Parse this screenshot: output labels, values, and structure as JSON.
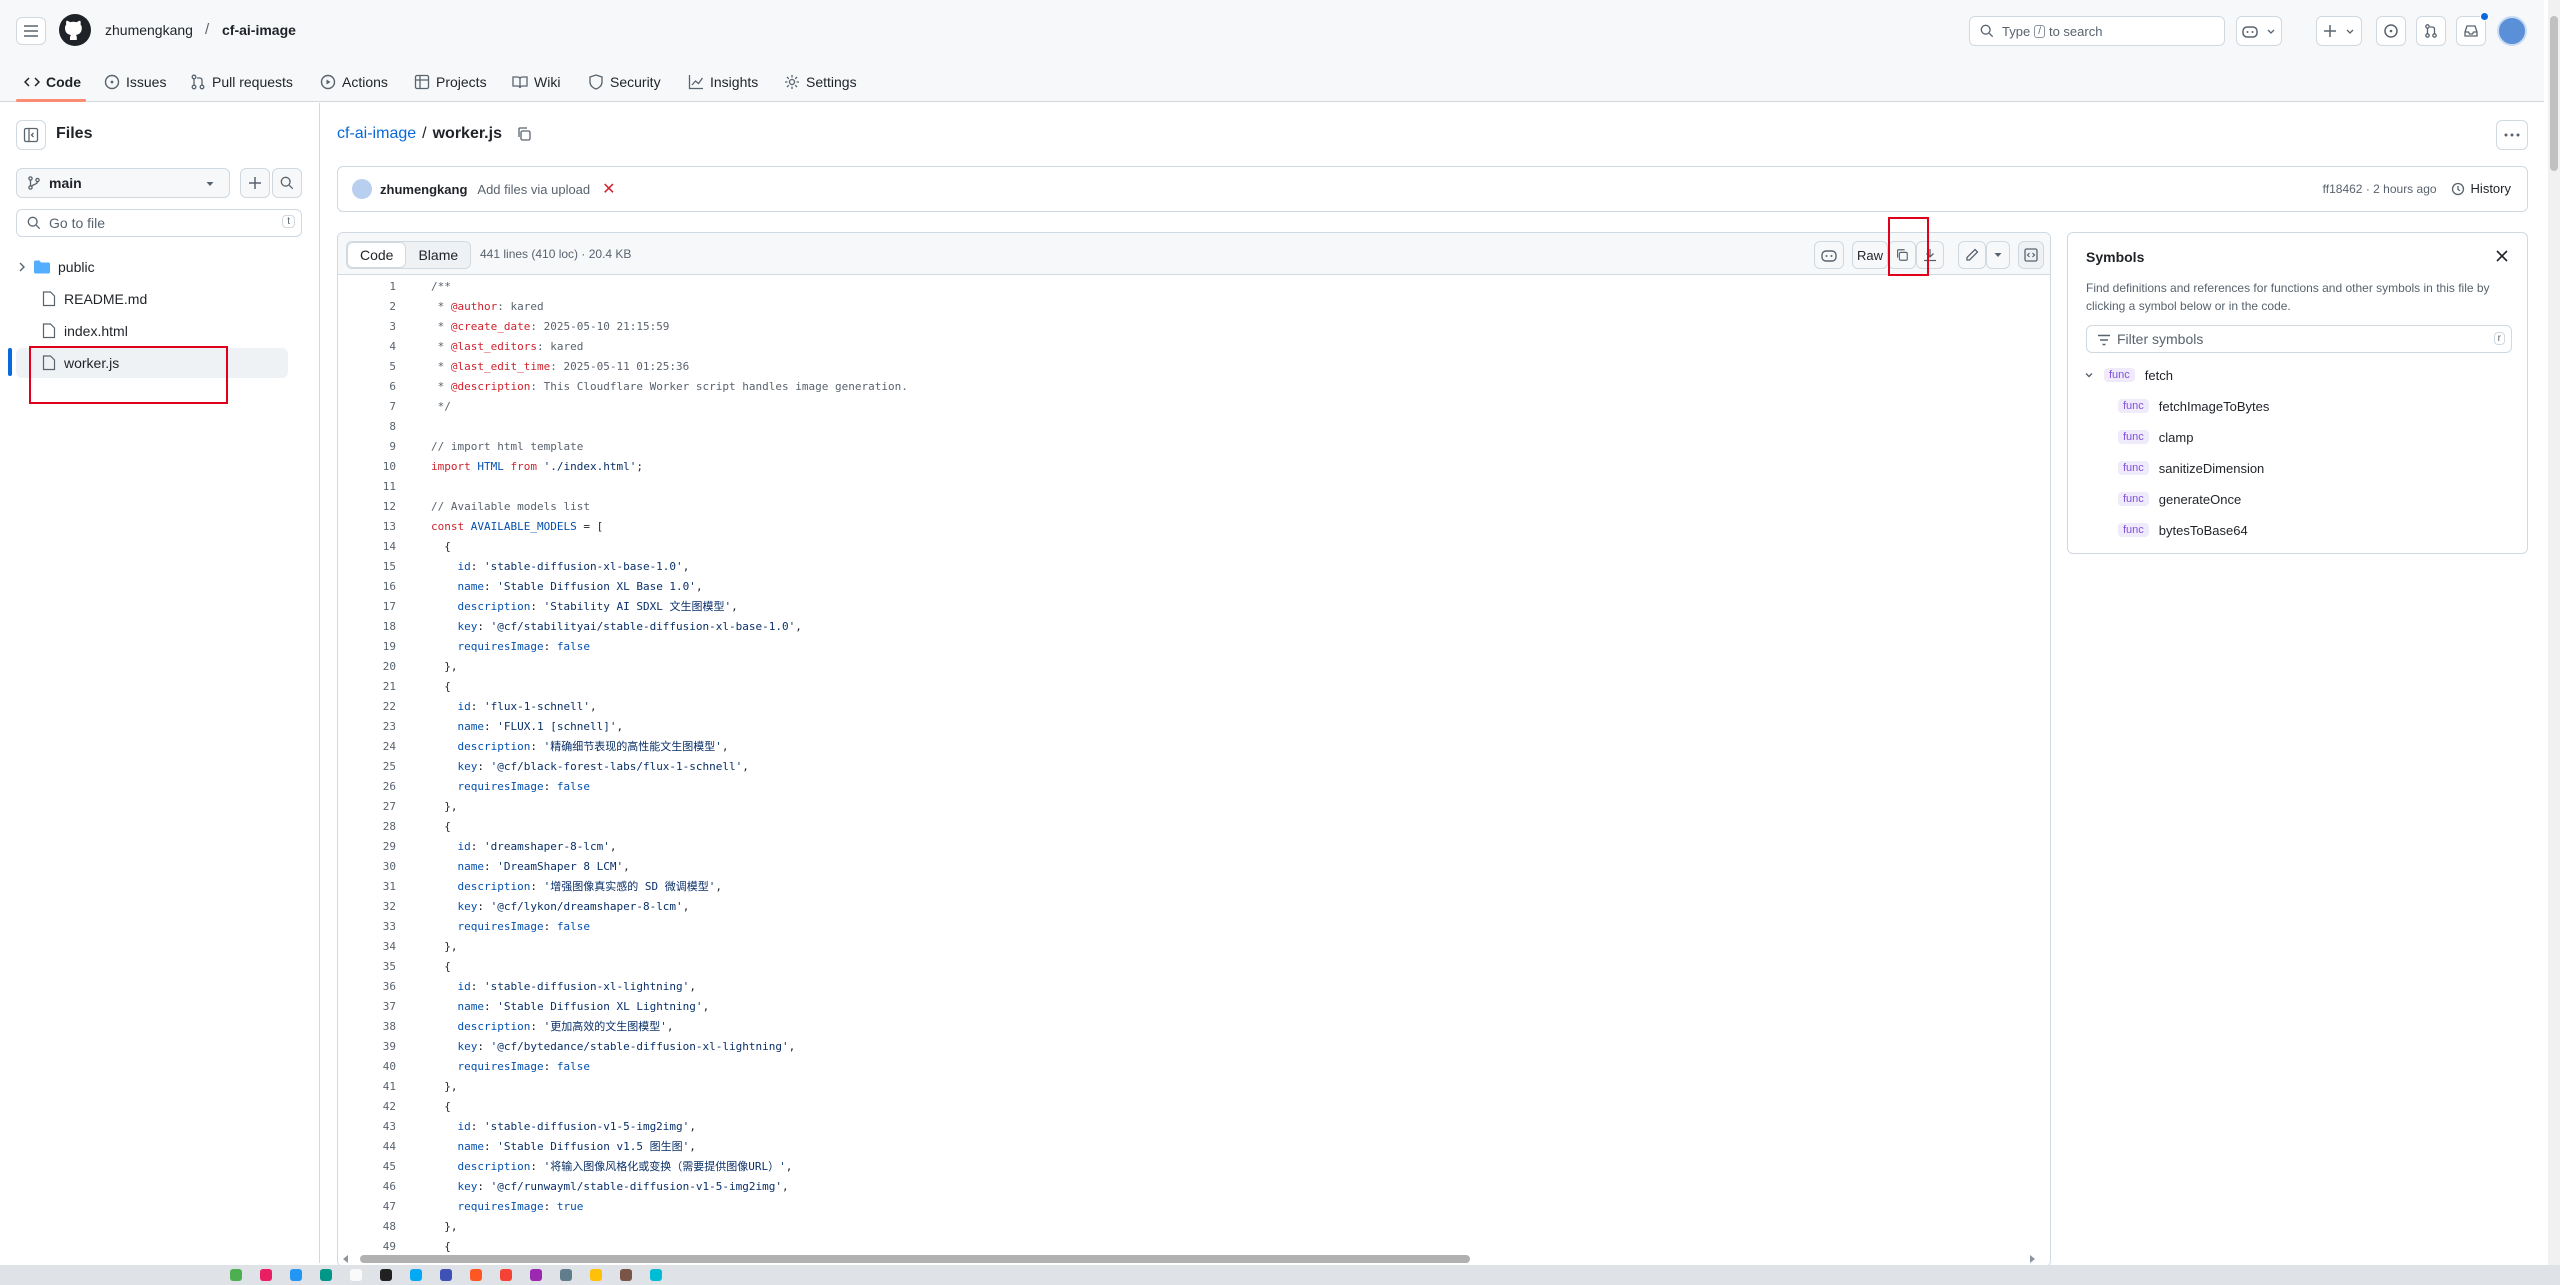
{
  "header": {
    "owner": "zhumengkang",
    "separator": "/",
    "repo": "cf-ai-image",
    "search_prefix": "Type",
    "search_key": "/",
    "search_suffix": "to search"
  },
  "nav_tabs": [
    {
      "label": "Code",
      "icon": "code-icon"
    },
    {
      "label": "Issues",
      "icon": "issue-icon"
    },
    {
      "label": "Pull requests",
      "icon": "pull-request-icon"
    },
    {
      "label": "Actions",
      "icon": "actions-icon"
    },
    {
      "label": "Projects",
      "icon": "projects-icon"
    },
    {
      "label": "Wiki",
      "icon": "wiki-icon"
    },
    {
      "label": "Security",
      "icon": "shield-icon"
    },
    {
      "label": "Insights",
      "icon": "graph-icon"
    },
    {
      "label": "Settings",
      "icon": "gear-icon"
    }
  ],
  "sidebar": {
    "title": "Files",
    "branch": "main",
    "goto_placeholder": "Go to file",
    "goto_key": "t",
    "tree": [
      {
        "name": "public",
        "type": "folder"
      },
      {
        "name": "README.md",
        "type": "file"
      },
      {
        "name": "index.html",
        "type": "file"
      },
      {
        "name": "worker.js",
        "type": "file",
        "selected": true
      }
    ]
  },
  "path": {
    "repo": "cf-ai-image",
    "sep": "/",
    "file": "worker.js"
  },
  "commit": {
    "author": "zhumengkang",
    "message": "Add files via upload",
    "status": "✕",
    "sha": "ff18462",
    "time": "· 2 hours ago",
    "history": "History"
  },
  "code_toolbar": {
    "tab_code": "Code",
    "tab_blame": "Blame",
    "meta": "441 lines (410 loc) · 20.4 KB",
    "raw": "Raw"
  },
  "code_lines": [
    {
      "n": "1",
      "t": "/**"
    },
    {
      "n": "2",
      "t": " * @author: kared"
    },
    {
      "n": "3",
      "t": " * @create_date: 2025-05-10 21:15:59"
    },
    {
      "n": "4",
      "t": " * @last_editors: kared"
    },
    {
      "n": "5",
      "t": " * @last_edit_time: 2025-05-11 01:25:36"
    },
    {
      "n": "6",
      "t": " * @description: This Cloudflare Worker script handles image generation."
    },
    {
      "n": "7",
      "t": " */"
    },
    {
      "n": "8",
      "t": ""
    },
    {
      "n": "9",
      "t": "// import html template"
    },
    {
      "n": "10",
      "t": "import HTML from './index.html';"
    },
    {
      "n": "11",
      "t": ""
    },
    {
      "n": "12",
      "t": "// Available models list"
    },
    {
      "n": "13",
      "t": "const AVAILABLE_MODELS = ["
    },
    {
      "n": "14",
      "t": "  {"
    },
    {
      "n": "15",
      "t": "    id: 'stable-diffusion-xl-base-1.0',"
    },
    {
      "n": "16",
      "t": "    name: 'Stable Diffusion XL Base 1.0',"
    },
    {
      "n": "17",
      "t": "    description: 'Stability AI SDXL 文生图模型',"
    },
    {
      "n": "18",
      "t": "    key: '@cf/stabilityai/stable-diffusion-xl-base-1.0',"
    },
    {
      "n": "19",
      "t": "    requiresImage: false"
    },
    {
      "n": "20",
      "t": "  },"
    },
    {
      "n": "21",
      "t": "  {"
    },
    {
      "n": "22",
      "t": "    id: 'flux-1-schnell',"
    },
    {
      "n": "23",
      "t": "    name: 'FLUX.1 [schnell]',"
    },
    {
      "n": "24",
      "t": "    description: '精确细节表现的高性能文生图模型',"
    },
    {
      "n": "25",
      "t": "    key: '@cf/black-forest-labs/flux-1-schnell',"
    },
    {
      "n": "26",
      "t": "    requiresImage: false"
    },
    {
      "n": "27",
      "t": "  },"
    },
    {
      "n": "28",
      "t": "  {"
    },
    {
      "n": "29",
      "t": "    id: 'dreamshaper-8-lcm',"
    },
    {
      "n": "30",
      "t": "    name: 'DreamShaper 8 LCM',"
    },
    {
      "n": "31",
      "t": "    description: '增强图像真实感的 SD 微调模型',"
    },
    {
      "n": "32",
      "t": "    key: '@cf/lykon/dreamshaper-8-lcm',"
    },
    {
      "n": "33",
      "t": "    requiresImage: false"
    },
    {
      "n": "34",
      "t": "  },"
    },
    {
      "n": "35",
      "t": "  {"
    },
    {
      "n": "36",
      "t": "    id: 'stable-diffusion-xl-lightning',"
    },
    {
      "n": "37",
      "t": "    name: 'Stable Diffusion XL Lightning',"
    },
    {
      "n": "38",
      "t": "    description: '更加高效的文生图模型',"
    },
    {
      "n": "39",
      "t": "    key: '@cf/bytedance/stable-diffusion-xl-lightning',"
    },
    {
      "n": "40",
      "t": "    requiresImage: false"
    },
    {
      "n": "41",
      "t": "  },"
    },
    {
      "n": "42",
      "t": "  {"
    },
    {
      "n": "43",
      "t": "    id: 'stable-diffusion-v1-5-img2img',"
    },
    {
      "n": "44",
      "t": "    name: 'Stable Diffusion v1.5 图生图',"
    },
    {
      "n": "45",
      "t": "    description: '将输入图像风格化或变换（需要提供图像URL）',"
    },
    {
      "n": "46",
      "t": "    key: '@cf/runwayml/stable-diffusion-v1-5-img2img',"
    },
    {
      "n": "47",
      "t": "    requiresImage: true"
    },
    {
      "n": "48",
      "t": "  },"
    },
    {
      "n": "49",
      "t": "  {"
    }
  ],
  "symbols": {
    "title": "Symbols",
    "description": "Find definitions and references for functions and other symbols in this file by clicking a symbol below or in the code.",
    "filter_placeholder": "Filter symbols",
    "filter_key": "r",
    "badge": "func",
    "root": "fetch",
    "children": [
      "fetchImageToBytes",
      "clamp",
      "sanitizeDimension",
      "generateOnce",
      "bytesToBase64"
    ]
  },
  "colors": {
    "accent": "#0969da",
    "active_tab_underline": "#fd8c73",
    "highlight_box": "#e0001b",
    "keyword": "#cf222e",
    "string": "#0a3069",
    "constant": "#0550ae",
    "func_badge": "#8250df"
  }
}
